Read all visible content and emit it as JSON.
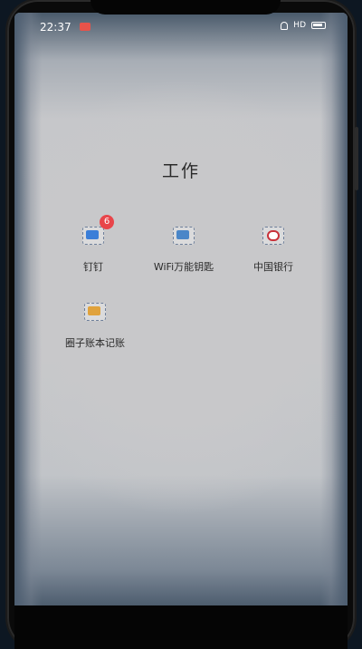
{
  "status_bar": {
    "time": "22:37",
    "network": "HD"
  },
  "folder": {
    "title": "工作",
    "apps": [
      {
        "label": "钉钉",
        "badge": "6",
        "icon": "dingtalk-icon",
        "color": "#3b7ed8"
      },
      {
        "label": "WiFi万能钥匙",
        "badge": "",
        "icon": "wifi-key-icon",
        "color": "#4a86c8"
      },
      {
        "label": "中国银行",
        "badge": "",
        "icon": "bank-of-china-icon",
        "color": "#c8323a"
      },
      {
        "label": "圈子账本记账",
        "badge": "",
        "icon": "ledger-icon",
        "color": "#e0a23c"
      }
    ]
  },
  "colors": {
    "badge": "#e8454a",
    "folder_bg": "#c7c8cc"
  }
}
